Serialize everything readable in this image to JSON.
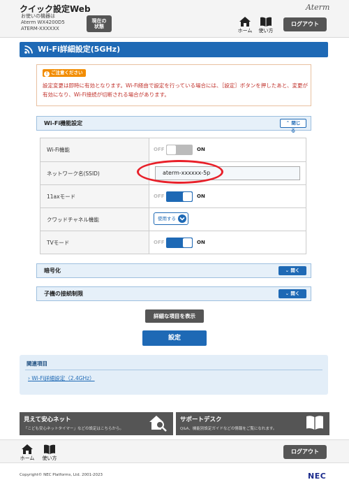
{
  "header": {
    "app_title": "クイック設定Web",
    "device_line1": "お使いの機器は",
    "device_line2": "Aterm WX4200D5",
    "device_line3": "ATERM-XXXXXX",
    "status_btn_line1": "現在の",
    "status_btn_line2": "状態",
    "brand": "Aterm",
    "home_label": "ホーム",
    "howto_label": "使い方",
    "logout_label": "ログアウト"
  },
  "page": {
    "title": "Wi-Fi詳細設定(5GHz)"
  },
  "notice": {
    "badge": "ご注意ください",
    "text": "設定変更は即時に有効となります。Wi-Fi経由で設定を行っている場合には、［設定］ボタンを押したあと、変更が有効になり、Wi-Fi接続が切断される場合があります。"
  },
  "wifi_section": {
    "title": "Wi-Fi機能設定",
    "close_label": "閉じる",
    "rows": [
      {
        "label": "Wi-Fi機能",
        "off": "OFF",
        "on": "ON",
        "state": "off"
      },
      {
        "label": "ネットワーク名(SSID)",
        "value": "aterm-xxxxxx-5p"
      },
      {
        "label": "11axモード",
        "off": "OFF",
        "on": "ON",
        "state": "on"
      },
      {
        "label": "クワッドチャネル機能",
        "select_value": "使用する"
      },
      {
        "label": "TVモード",
        "off": "OFF",
        "on": "ON",
        "state": "on"
      }
    ]
  },
  "encryption_section": {
    "title": "暗号化",
    "open_label": "開く"
  },
  "child_section": {
    "title": "子機の接続制限",
    "open_label": "開く"
  },
  "buttons": {
    "detail": "詳細な項目を表示",
    "submit": "設定"
  },
  "related": {
    "title": "関連項目",
    "link": "Wi-Fi詳細設定（2.4GHz）"
  },
  "banners": [
    {
      "title": "見えて安心ネット",
      "desc": "「こども安心ネットタイマー」などの設定はこちらから。"
    },
    {
      "title": "サポートデスク",
      "desc": "Q&A、機能別設定ガイドなどの情報をご覧になれます。"
    }
  ],
  "footer": {
    "home_label": "ホーム",
    "howto_label": "使い方",
    "logout_label": "ログアウト",
    "copyright": "Copyright© NEC Platforms, Ltd. 2001-2023",
    "logo": "NEC"
  },
  "colors": {
    "accent": "#1e69b5",
    "dark_button": "#555555",
    "notice_text": "#c0302a",
    "highlight": "#e8202a"
  }
}
